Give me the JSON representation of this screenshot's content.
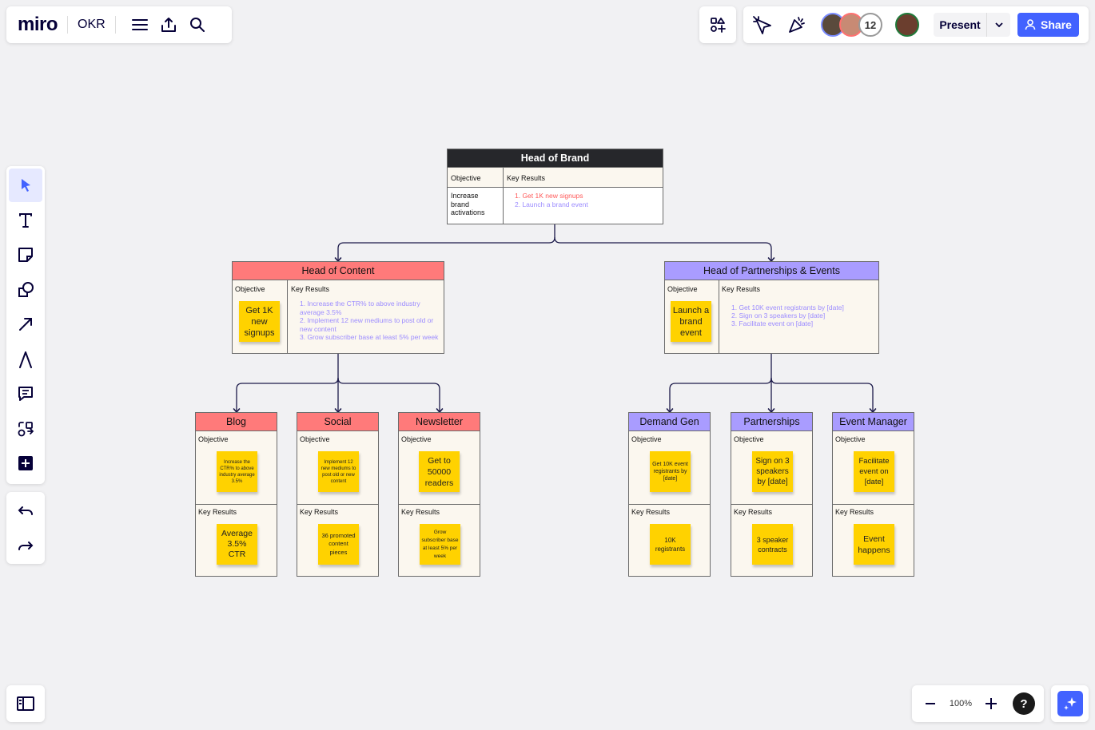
{
  "app": {
    "logo": "miro",
    "board_name": "OKR"
  },
  "collab": {
    "avatar_count": "12",
    "present_label": "Present",
    "share_label": "Share"
  },
  "zoom": {
    "level": "100%",
    "help": "?"
  },
  "board": {
    "brand": {
      "title": "Head of Brand",
      "objective_header": "Objective",
      "kr_header": "Key Results",
      "objective": "Increase brand activations",
      "key_results": [
        "1. Get 1K new signups",
        "2. Launch a brand event"
      ]
    },
    "content": {
      "title": "Head of Content",
      "objective_header": "Objective",
      "kr_header": "Key Results",
      "sticky": "Get 1K new signups",
      "key_results": [
        "1. Increase the CTR% to above industry average 3.5%",
        "2. Implement 12 new mediums to post old or new content",
        "3. Grow subscriber base at least 5% per week"
      ]
    },
    "partnerships_events": {
      "title": "Head of Partnerships & Events",
      "objective_header": "Objective",
      "kr_header": "Key Results",
      "sticky": "Launch a brand event",
      "key_results": [
        "1. Get 10K event registrants by [date]",
        "2. Sign on 3 speakers by [date]",
        "3. Facilitate event on [date]"
      ]
    },
    "teams": [
      {
        "title": "Blog",
        "objective_label": "Objective",
        "objective": "Increase the CTR% to above industry average 3.5%",
        "kr_label": "Key Results",
        "kr": "Average 3.5% CTR"
      },
      {
        "title": "Social",
        "objective_label": "Objective",
        "objective": "Implement 12 new mediums to post old or new content",
        "kr_label": "Key Results",
        "kr": "36 promoted content pieces"
      },
      {
        "title": "Newsletter",
        "objective_label": "Objective",
        "objective": "Get to 50000 readers",
        "kr_label": "Key Results",
        "kr": "Grow subscriber base at least 5% per week"
      },
      {
        "title": "Demand Gen",
        "objective_label": "Objective",
        "objective": "Get 10K event registrants by [date]",
        "kr_label": "Key Results",
        "kr": "10K registrants"
      },
      {
        "title": "Partnerships",
        "objective_label": "Objective",
        "objective": "Sign on 3 speakers by [date]",
        "kr_label": "Key Results",
        "kr": "3 speaker contracts"
      },
      {
        "title": "Event Manager",
        "objective_label": "Objective",
        "objective": "Facilitate event on [date]",
        "kr_label": "Key Results",
        "kr": "Event happens"
      }
    ]
  },
  "colors": {
    "accent": "#4262ff",
    "content_header": "#ff7a7a",
    "partnerships_header": "#a99cff",
    "brand_header": "#26272b",
    "sticky": "#ffd200"
  }
}
